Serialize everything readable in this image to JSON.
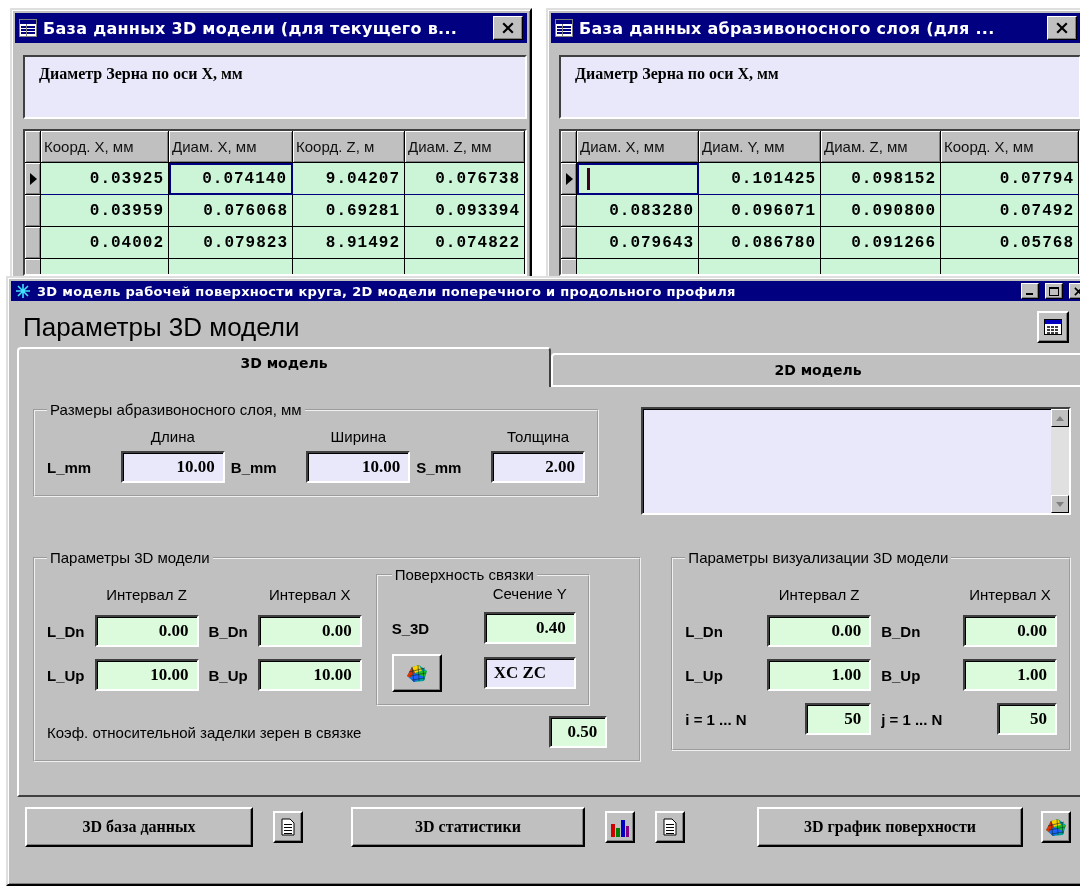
{
  "db_windows": [
    {
      "title": "База данных 3D модели (для текущего в...",
      "caption": "Диаметр Зерна по оси X, мм",
      "columns": [
        "Коорд. X, мм",
        "Диам. X, мм",
        "Коорд. Z, м",
        "Диам. Z, мм"
      ],
      "rows": [
        {
          "selected": true,
          "cells": [
            {
              "text": "0.03925",
              "focused": false
            },
            {
              "text": "0.074140",
              "focused": true
            },
            {
              "text": "9.04207",
              "focused": false
            },
            {
              "text": "0.076738",
              "focused": false
            }
          ]
        },
        {
          "selected": false,
          "cells": [
            {
              "text": "0.03959",
              "focused": false
            },
            {
              "text": "0.076068",
              "focused": false
            },
            {
              "text": "0.69281",
              "focused": false
            },
            {
              "text": "0.093394",
              "focused": false
            }
          ]
        },
        {
          "selected": false,
          "cells": [
            {
              "text": "0.04002",
              "focused": false
            },
            {
              "text": "0.079823",
              "focused": false
            },
            {
              "text": "8.91492",
              "focused": false
            },
            {
              "text": "0.074822",
              "focused": false
            }
          ]
        }
      ]
    },
    {
      "title": "База данных абразивоносного слоя (для ...",
      "caption": "Диаметр Зерна по оси X, мм",
      "columns": [
        "Диам. X, мм",
        "Диам. Y, мм",
        "Диам. Z, мм",
        "Коорд. X, мм"
      ],
      "rows": [
        {
          "selected": true,
          "cells": [
            {
              "focused": true
            },
            {
              "text": "0.101425",
              "focused": false
            },
            {
              "text": "0.098152",
              "focused": false
            },
            {
              "text": "0.07794",
              "focused": false
            }
          ]
        },
        {
          "selected": false,
          "cells": [
            {
              "text": "0.083280",
              "focused": false
            },
            {
              "text": "0.096071",
              "focused": false
            },
            {
              "text": "0.090800",
              "focused": false
            },
            {
              "text": "0.07492",
              "focused": false
            }
          ]
        },
        {
          "selected": false,
          "cells": [
            {
              "text": "0.079643",
              "focused": false
            },
            {
              "text": "0.086780",
              "focused": false
            },
            {
              "text": "0.091266",
              "focused": false
            },
            {
              "text": "0.05768",
              "focused": false
            }
          ]
        }
      ]
    }
  ],
  "main_window": {
    "title": "3D модель рабочей поверхности круга, 2D модели поперечного и продольного профиля",
    "heading": "Параметры 3D модели",
    "tabs": [
      {
        "label": "3D модель",
        "selected": true
      },
      {
        "label": "2D модель",
        "selected": false
      }
    ],
    "layer_group": {
      "title": "Размеры абразивоносного слоя, мм",
      "fields": [
        {
          "column_label": "Длина",
          "label": "L_mm",
          "value": "10.00"
        },
        {
          "column_label": "Ширина",
          "label": "B_mm",
          "value": "10.00"
        },
        {
          "column_label": "Толщина",
          "label": "S_mm",
          "value": "2.00"
        }
      ]
    },
    "model_group": {
      "title": "Параметры 3D модели",
      "column_labels": [
        "Интервал Z",
        "Интервал X"
      ],
      "rows": [
        {
          "fields": [
            {
              "label": "L_Dn",
              "value": "0.00"
            },
            {
              "label": "B_Dn",
              "value": "0.00"
            }
          ]
        },
        {
          "fields": [
            {
              "label": "L_Up",
              "value": "10.00"
            },
            {
              "label": "B_Up",
              "value": "10.00"
            }
          ]
        }
      ],
      "coefficient": {
        "label": "Коэф. относительной заделки зерен в связке",
        "value": "0.50"
      }
    },
    "bond_group": {
      "title": "Поверхность связки",
      "column_label": "Сечение Y",
      "label": "S_3D",
      "value": "0.40",
      "section": "XC ZC"
    },
    "vis_group": {
      "title": "Параметры визуализации 3D модели",
      "column_labels": [
        "Интервал Z",
        "Интервал X"
      ],
      "rows": [
        {
          "fields": [
            {
              "label": "L_Dn",
              "value": "0.00"
            },
            {
              "label": "B_Dn",
              "value": "0.00"
            }
          ]
        },
        {
          "fields": [
            {
              "label": "L_Up",
              "value": "1.00"
            },
            {
              "label": "B_Up",
              "value": "1.00"
            }
          ]
        },
        {
          "fields": [
            {
              "label": "i = 1 ... N",
              "value": "50"
            },
            {
              "label": "j = 1 ... N",
              "value": "50"
            }
          ]
        }
      ]
    },
    "buttons": [
      {
        "kind": "text",
        "label": "3D база данных"
      },
      {
        "kind": "document"
      },
      {
        "kind": "text",
        "label": "3D статистики"
      },
      {
        "kind": "chart"
      },
      {
        "kind": "document"
      },
      {
        "kind": "text",
        "label": "3D график поверхности"
      },
      {
        "kind": "surface"
      }
    ]
  }
}
